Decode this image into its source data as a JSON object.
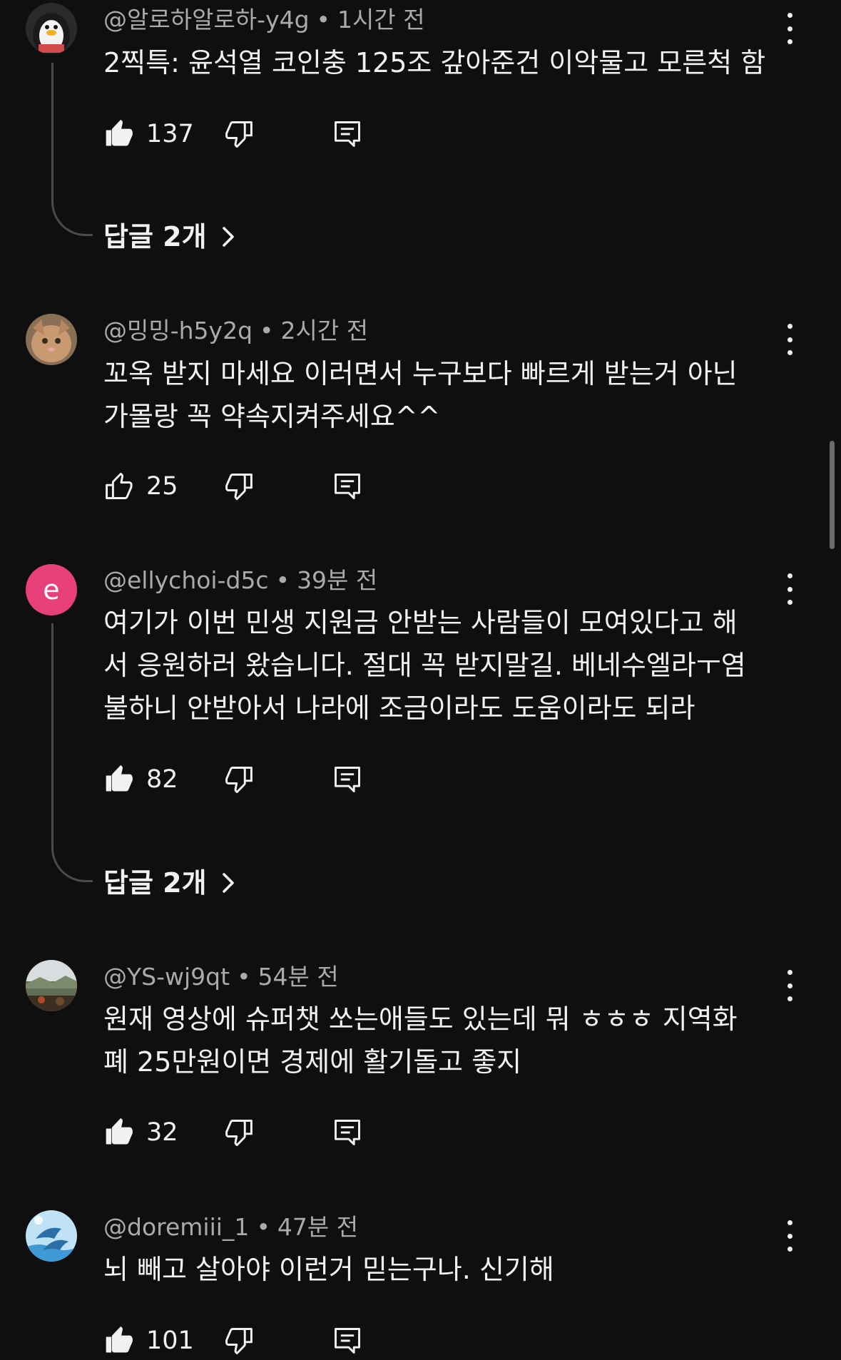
{
  "comments": [
    {
      "handle": "@알로하알로하-y4g",
      "time": "1시간 전",
      "text": "2찍특: 윤석열 코인충 125조 갚아준건 이악물고 모른척 함",
      "likes": "137",
      "liked": true,
      "avatar": "penguin-avatar",
      "replies_label": "답글 2개"
    },
    {
      "handle": "@밍밍-h5y2q",
      "time": "2시간 전",
      "text": "꼬옥 받지 마세요 이러면서 누구보다 빠르게 받는거 아닌\n가몰랑 꼭 약속지켜주세요^^",
      "likes": "25",
      "liked": false,
      "avatar": "cat-avatar"
    },
    {
      "handle": "@ellychoi-d5c",
      "time": "39분 전",
      "text": "여기가 이번 민생 지원금 안받는 사람들이 모여있다고 해\n서 응원하러 왔습니다. 절대 꼭 받지말길. 베네수엘라ㅜ염\n불하니 안받아서 나라에 조금이라도 도움이라도 되라",
      "likes": "82",
      "liked": true,
      "avatar_letter": "e",
      "avatar_color": "#e8407a",
      "replies_label": "답글 2개"
    },
    {
      "handle": "@YS-wj9qt",
      "time": "54분 전",
      "text": "원재 영상에 슈퍼챗 쏘는애들도 있는데 뭐 ㅎㅎㅎ 지역화\n폐 25만원이면 경제에 활기돌고 좋지",
      "likes": "32",
      "liked": true,
      "avatar": "landscape-avatar"
    },
    {
      "handle": "@doremiii_1",
      "time": "47분 전",
      "text": "뇌 빼고 살아야 이런거 믿는구나. 신기해",
      "likes": "101",
      "liked": true,
      "avatar": "dolphin-avatar"
    }
  ],
  "dot": "•",
  "colors": {
    "background": "#0f0f0f",
    "text": "#f1f1f1",
    "meta": "#aaaaaa"
  }
}
